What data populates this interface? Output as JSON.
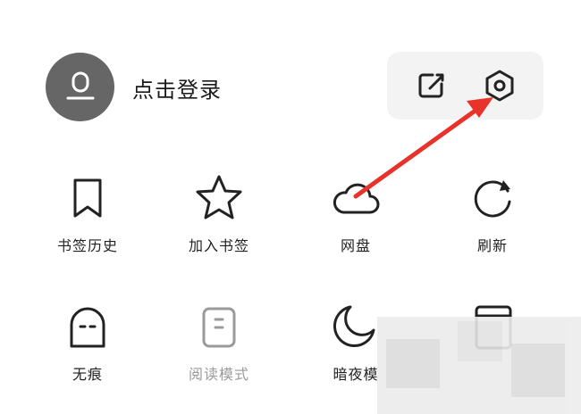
{
  "header": {
    "login_label": "点击登录"
  },
  "toolbar": {
    "share_icon": "share-icon",
    "settings_icon": "settings-hexagon-icon"
  },
  "menu_row1": [
    {
      "label": "书签历史",
      "icon": "bookmark-icon"
    },
    {
      "label": "加入书签",
      "icon": "star-icon"
    },
    {
      "label": "网盘",
      "icon": "cloud-icon"
    },
    {
      "label": "刷新",
      "icon": "refresh-icon"
    }
  ],
  "menu_row2": [
    {
      "label": "无痕",
      "icon": "ghost-icon"
    },
    {
      "label": "阅读模式",
      "icon": "reader-mode-icon"
    },
    {
      "label": "暗夜模",
      "icon": "moon-icon"
    },
    {
      "label": "",
      "icon": "window-icon"
    }
  ],
  "colors": {
    "accent_arrow": "#e8332a",
    "avatar_bg": "#666666",
    "toolbar_bg": "#f3f3f3"
  }
}
